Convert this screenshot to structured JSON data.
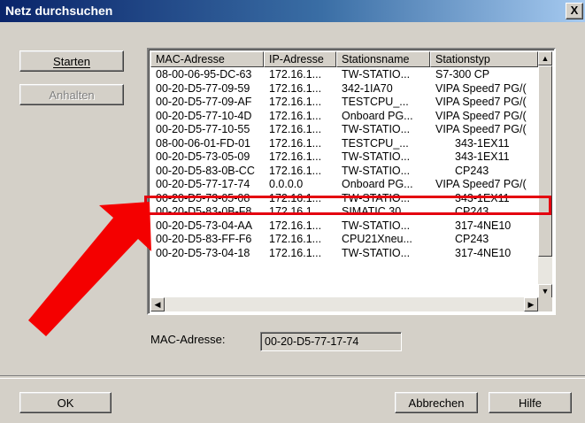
{
  "window": {
    "title": "Netz durchsuchen",
    "close_label": "X"
  },
  "buttons": {
    "start": "Starten",
    "stop": "Anhalten",
    "ok": "OK",
    "cancel": "Abbrechen",
    "help": "Hilfe"
  },
  "table": {
    "columns": [
      "MAC-Adresse",
      "IP-Adresse",
      "Stationsname",
      "Stationstyp"
    ],
    "rows": [
      [
        "08-00-06-95-DC-63",
        "172.16.1...",
        "TW-STATIO...",
        "S7-300 CP"
      ],
      [
        "00-20-D5-77-09-59",
        "172.16.1...",
        "342-1IA70",
        "VIPA Speed7 PG/("
      ],
      [
        "00-20-D5-77-09-AF",
        "172.16.1...",
        "TESTCPU_...",
        "VIPA Speed7 PG/("
      ],
      [
        "00-20-D5-77-10-4D",
        "172.16.1...",
        "Onboard PG...",
        "VIPA Speed7 PG/("
      ],
      [
        "00-20-D5-77-10-55",
        "172.16.1...",
        "TW-STATIO...",
        "VIPA Speed7 PG/("
      ],
      [
        "08-00-06-01-FD-01",
        "172.16.1...",
        "TESTCPU_...",
        "343-1EX11"
      ],
      [
        "00-20-D5-73-05-09",
        "172.16.1...",
        "TW-STATIO...",
        "343-1EX11"
      ],
      [
        "00-20-D5-83-0B-CC",
        "172.16.1...",
        "TW-STATIO...",
        "CP243"
      ],
      [
        "00-20-D5-77-17-74",
        "0.0.0.0",
        "Onboard PG...",
        "VIPA Speed7 PG/("
      ],
      [
        "00-20-D5-73-05-08",
        "172.16.1...",
        "TW-STATIO...",
        "343-1EX11"
      ],
      [
        "00-20-D5-83-0B-F8",
        "172.16.1...",
        "SIMATIC 30...",
        "CP243"
      ],
      [
        "00-20-D5-73-04-AA",
        "172.16.1...",
        "TW-STATIO...",
        "317-4NE10"
      ],
      [
        "00-20-D5-83-FF-F6",
        "172.16.1...",
        "CPU21Xneu...",
        "CP243"
      ],
      [
        "00-20-D5-73-04-18",
        "172.16.1...",
        "TW-STATIO...",
        "317-4NE10"
      ]
    ],
    "highlighted_row": 8
  },
  "mac": {
    "label": "MAC-Adresse:",
    "value": "00-20-D5-77-17-74"
  },
  "colors": {
    "highlight": "#e4000f",
    "arrow": "#f40000",
    "titlebar": "#0a246a"
  }
}
